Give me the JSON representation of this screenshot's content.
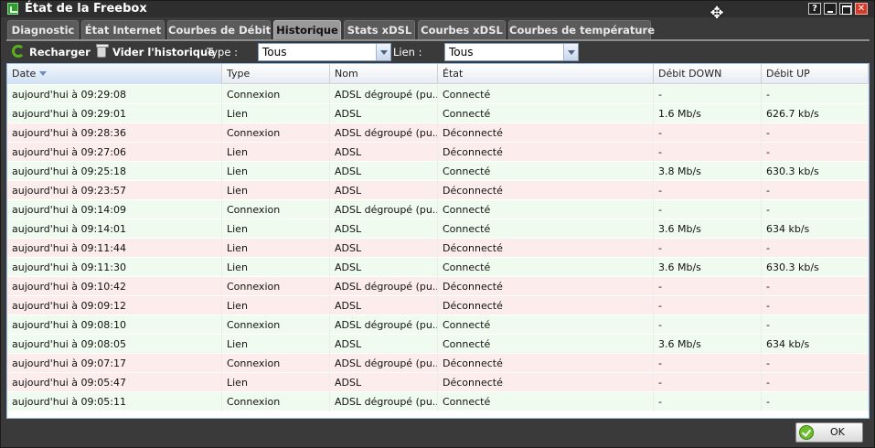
{
  "window": {
    "title": "État de la Freebox"
  },
  "tabs": [
    {
      "label": "Diagnostic"
    },
    {
      "label": "État Internet"
    },
    {
      "label": "Courbes de Débit"
    },
    {
      "label": "Historique"
    },
    {
      "label": "Stats xDSL"
    },
    {
      "label": "Courbes xDSL"
    },
    {
      "label": "Courbes de température"
    }
  ],
  "active_tab": "Historique",
  "toolbar": {
    "reload_label": "Recharger",
    "clear_label": "Vider l'historique",
    "type_label": "Type :",
    "type_value": "Tous",
    "link_label": "Lien :",
    "link_value": "Tous"
  },
  "grid": {
    "columns": [
      "Date",
      "Type",
      "Nom",
      "État",
      "Débit DOWN",
      "Débit UP"
    ],
    "sorted_column": "Date",
    "rows": [
      {
        "date": "aujourd'hui à 09:29:08",
        "type": "Connexion",
        "name": "ADSL dégroupé (pu...",
        "state": "Connecté",
        "down": "-",
        "up": "-"
      },
      {
        "date": "aujourd'hui à 09:29:01",
        "type": "Lien",
        "name": "ADSL",
        "state": "Connecté",
        "down": "1.6 Mb/s",
        "up": "626.7 kb/s"
      },
      {
        "date": "aujourd'hui à 09:28:36",
        "type": "Connexion",
        "name": "ADSL dégroupé (pu...",
        "state": "Déconnecté",
        "down": "-",
        "up": "-"
      },
      {
        "date": "aujourd'hui à 09:27:06",
        "type": "Lien",
        "name": "ADSL",
        "state": "Déconnecté",
        "down": "-",
        "up": "-"
      },
      {
        "date": "aujourd'hui à 09:25:18",
        "type": "Lien",
        "name": "ADSL",
        "state": "Connecté",
        "down": "3.8 Mb/s",
        "up": "630.3 kb/s"
      },
      {
        "date": "aujourd'hui à 09:23:57",
        "type": "Lien",
        "name": "ADSL",
        "state": "Déconnecté",
        "down": "-",
        "up": "-"
      },
      {
        "date": "aujourd'hui à 09:14:09",
        "type": "Connexion",
        "name": "ADSL dégroupé (pu...",
        "state": "Connecté",
        "down": "-",
        "up": "-"
      },
      {
        "date": "aujourd'hui à 09:14:01",
        "type": "Lien",
        "name": "ADSL",
        "state": "Connecté",
        "down": "3.6 Mb/s",
        "up": "634 kb/s"
      },
      {
        "date": "aujourd'hui à 09:11:44",
        "type": "Lien",
        "name": "ADSL",
        "state": "Déconnecté",
        "down": "-",
        "up": "-"
      },
      {
        "date": "aujourd'hui à 09:11:30",
        "type": "Lien",
        "name": "ADSL",
        "state": "Connecté",
        "down": "3.6 Mb/s",
        "up": "630.3 kb/s"
      },
      {
        "date": "aujourd'hui à 09:10:42",
        "type": "Connexion",
        "name": "ADSL dégroupé (pu...",
        "state": "Déconnecté",
        "down": "-",
        "up": "-"
      },
      {
        "date": "aujourd'hui à 09:09:12",
        "type": "Lien",
        "name": "ADSL",
        "state": "Déconnecté",
        "down": "-",
        "up": "-"
      },
      {
        "date": "aujourd'hui à 09:08:10",
        "type": "Connexion",
        "name": "ADSL dégroupé (pu...",
        "state": "Connecté",
        "down": "-",
        "up": "-"
      },
      {
        "date": "aujourd'hui à 09:08:05",
        "type": "Lien",
        "name": "ADSL",
        "state": "Connecté",
        "down": "3.6 Mb/s",
        "up": "634 kb/s"
      },
      {
        "date": "aujourd'hui à 09:07:17",
        "type": "Connexion",
        "name": "ADSL dégroupé (pu...",
        "state": "Déconnecté",
        "down": "-",
        "up": "-"
      },
      {
        "date": "aujourd'hui à 09:05:47",
        "type": "Lien",
        "name": "ADSL",
        "state": "Déconnecté",
        "down": "-",
        "up": "-"
      },
      {
        "date": "aujourd'hui à 09:05:11",
        "type": "Connexion",
        "name": "ADSL dégroupé (pu...",
        "state": "Connecté",
        "down": "-",
        "up": "-"
      }
    ]
  },
  "footer": {
    "ok_label": "OK"
  },
  "colors": {
    "connected_row": "#eefbee",
    "disconnected_row": "#fdecec",
    "active_tab": "#9a9a9a"
  }
}
